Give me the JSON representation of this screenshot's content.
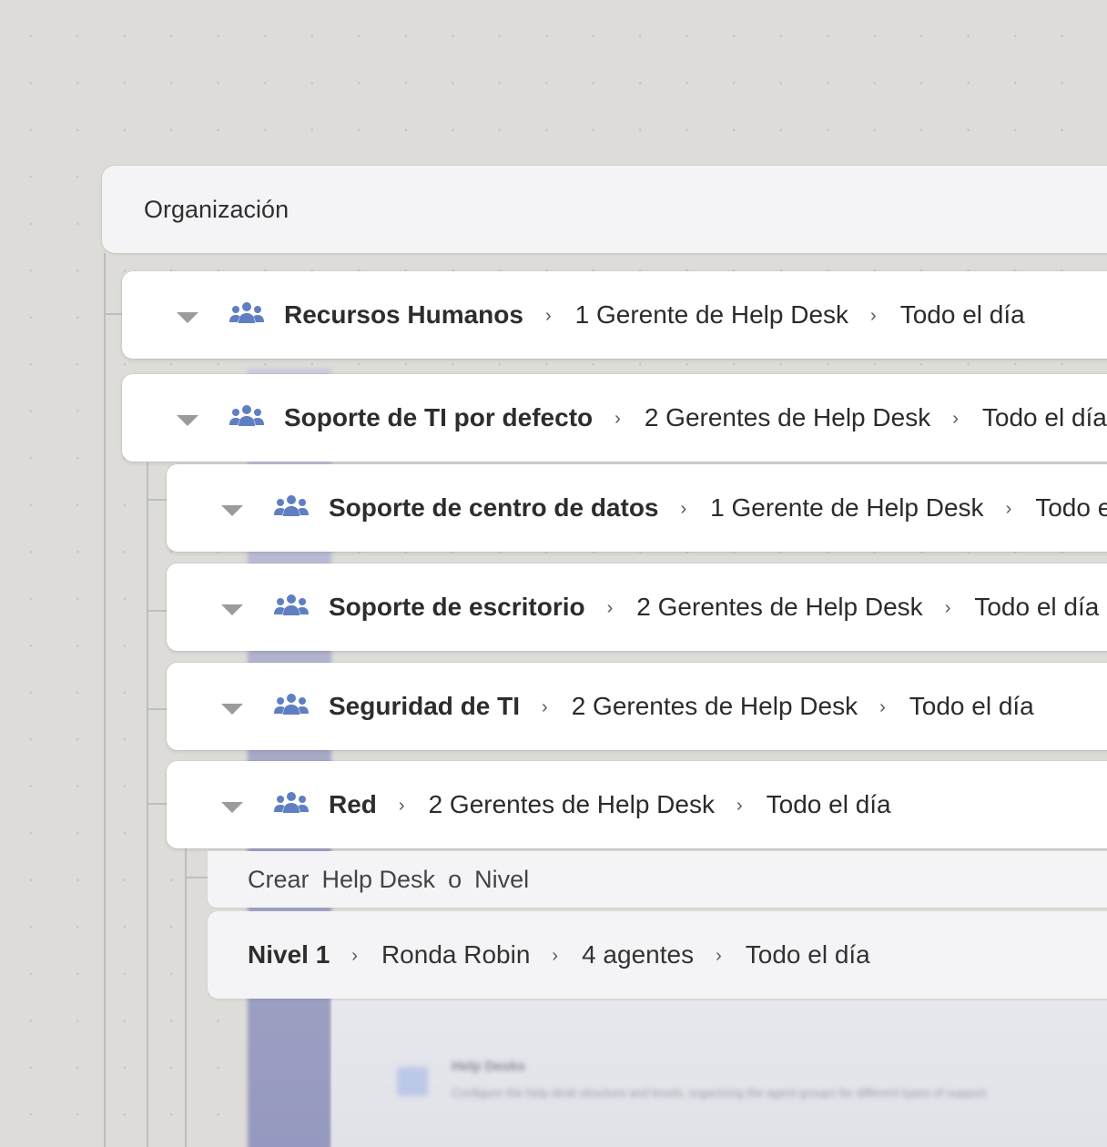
{
  "organization": {
    "title": "Organización"
  },
  "groups": [
    {
      "name": "Recursos Humanos",
      "managers": "1 Gerente de Help Desk",
      "schedule": "Todo el día",
      "icon": "users-group-icon"
    },
    {
      "name": "Soporte de TI por defecto",
      "managers": "2 Gerentes de Help Desk",
      "schedule": "Todo el día",
      "icon": "users-group-icon"
    },
    {
      "name": "Soporte de centro de datos",
      "managers": "1 Gerente de Help Desk",
      "schedule": "Todo el día",
      "icon": "users-group-icon"
    },
    {
      "name": "Soporte de escritorio",
      "managers": "2 Gerentes de Help Desk",
      "schedule": "Todo el día",
      "icon": "users-group-icon"
    },
    {
      "name": "Seguridad de TI",
      "managers": "2 Gerentes de Help Desk",
      "schedule": "Todo el día",
      "icon": "users-group-icon"
    },
    {
      "name": "Red",
      "managers": "2 Gerentes de Help Desk",
      "schedule": "Todo el día",
      "icon": "users-group-icon"
    }
  ],
  "create": {
    "verb": "Crear",
    "helpdesk": "Help Desk",
    "or": "o",
    "level": "Nivel"
  },
  "level": {
    "name": "Nivel 1",
    "routing": "Ronda Robin",
    "agents": "4 agentes",
    "schedule": "Todo el día"
  },
  "background": {
    "title": "Help Desks",
    "description": "Configure the help desk structure and levels, organizing the agent groups for different types of support"
  },
  "separator": "›",
  "colors": {
    "icon_blue": "#5f7fc2",
    "caret_gray": "#9b9b9b",
    "sidebar_purple": "#9699bf"
  }
}
